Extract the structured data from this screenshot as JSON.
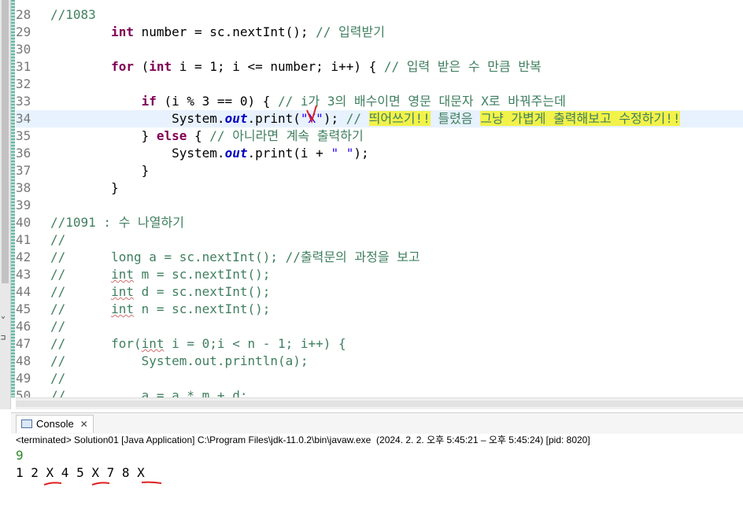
{
  "editor": {
    "lines": [
      {
        "n": "28",
        "segs": [
          {
            "t": "//1083",
            "c": "cm"
          }
        ]
      },
      {
        "n": "29",
        "segs": [
          {
            "t": "        "
          },
          {
            "t": "int",
            "c": "kw"
          },
          {
            "t": " number = sc.nextInt(); "
          },
          {
            "t": "// 입력받기",
            "c": "cm"
          }
        ]
      },
      {
        "n": "30",
        "segs": []
      },
      {
        "n": "31",
        "segs": [
          {
            "t": "        "
          },
          {
            "t": "for",
            "c": "kw"
          },
          {
            "t": " ("
          },
          {
            "t": "int",
            "c": "kw"
          },
          {
            "t": " i = 1; i <= number; i++) { "
          },
          {
            "t": "// 입력 받은 수 만큼 반복",
            "c": "cm"
          }
        ]
      },
      {
        "n": "32",
        "segs": []
      },
      {
        "n": "33",
        "segs": [
          {
            "t": "            "
          },
          {
            "t": "if",
            "c": "kw"
          },
          {
            "t": " (i % 3 == 0) { "
          },
          {
            "t": "// i가 3의 배수이면 영문 대문자 X로 바꿔주는데",
            "c": "cm"
          }
        ]
      },
      {
        "n": "34",
        "current": true,
        "segs": [
          {
            "t": "                System."
          },
          {
            "t": "out",
            "c": "fld"
          },
          {
            "t": ".print("
          },
          {
            "t": "\"X\"",
            "c": "st"
          },
          {
            "t": "); "
          },
          {
            "t": "// ",
            "c": "cm"
          },
          {
            "t": "띄어쓰기!!",
            "c": "cm hl"
          },
          {
            "t": " 틀렸음 ",
            "c": "cm"
          },
          {
            "t": "그냥 가볍게 출력해보고 수정하기!!",
            "c": "cm hl"
          }
        ]
      },
      {
        "n": "35",
        "segs": [
          {
            "t": "            } "
          },
          {
            "t": "else",
            "c": "kw"
          },
          {
            "t": " { "
          },
          {
            "t": "// 아니라면 계속 출력하기",
            "c": "cm"
          }
        ]
      },
      {
        "n": "36",
        "segs": [
          {
            "t": "                System."
          },
          {
            "t": "out",
            "c": "fld"
          },
          {
            "t": ".print(i + "
          },
          {
            "t": "\" \"",
            "c": "st"
          },
          {
            "t": ");"
          }
        ]
      },
      {
        "n": "37",
        "segs": [
          {
            "t": "            }"
          }
        ]
      },
      {
        "n": "38",
        "segs": [
          {
            "t": "        }"
          }
        ]
      },
      {
        "n": "39",
        "segs": []
      },
      {
        "n": "40",
        "segs": [
          {
            "t": "//1091 : 수 나열하기",
            "c": "cm"
          }
        ]
      },
      {
        "n": "41",
        "segs": [
          {
            "t": "//",
            "c": "cm"
          }
        ]
      },
      {
        "n": "42",
        "segs": [
          {
            "t": "//      long a = sc.nextInt(); //출력문의 과정을 보고",
            "c": "cm"
          }
        ]
      },
      {
        "n": "43",
        "segs": [
          {
            "t": "//      ",
            "c": "cm"
          },
          {
            "t": "int",
            "c": "cm squig"
          },
          {
            "t": " m = sc.nextInt();",
            "c": "cm"
          }
        ]
      },
      {
        "n": "44",
        "segs": [
          {
            "t": "//      ",
            "c": "cm"
          },
          {
            "t": "int",
            "c": "cm squig"
          },
          {
            "t": " d = sc.nextInt();",
            "c": "cm"
          }
        ]
      },
      {
        "n": "45",
        "segs": [
          {
            "t": "//      ",
            "c": "cm"
          },
          {
            "t": "int",
            "c": "cm squig"
          },
          {
            "t": " n = sc.nextInt();",
            "c": "cm"
          }
        ]
      },
      {
        "n": "46",
        "segs": [
          {
            "t": "//",
            "c": "cm"
          }
        ]
      },
      {
        "n": "47",
        "segs": [
          {
            "t": "//      for(",
            "c": "cm"
          },
          {
            "t": "int",
            "c": "cm squig"
          },
          {
            "t": " i = 0;i < n - 1; i++) {",
            "c": "cm"
          }
        ]
      },
      {
        "n": "48",
        "segs": [
          {
            "t": "//          System.out.println(a);",
            "c": "cm"
          }
        ]
      },
      {
        "n": "49",
        "segs": [
          {
            "t": "//",
            "c": "cm"
          }
        ]
      },
      {
        "n": "50",
        "segs": [
          {
            "t": "//          a = a * m + d;",
            "c": "cm"
          }
        ]
      }
    ]
  },
  "console": {
    "tab_label": "Console",
    "close_symbol": "✕",
    "terminated_text": "<terminated> Solution01 [Java Application] C:\\Program Files\\jdk-11.0.2\\bin\\javaw.exe  (2024. 2. 2. 오후 5:45:21 – 오후 5:45:24) [pid: 8020]",
    "output_line1": "9",
    "output_line2": "1 2 X 4 5 X 7 8 X "
  },
  "colors": {
    "keyword": "#7f0055",
    "comment": "#3f7f5f",
    "string": "#2a00ff",
    "highlight": "#f2f24a",
    "annotation": "#e02020"
  },
  "icons": [
    "console-icon",
    "close-icon",
    "chevron-down-icon"
  ]
}
